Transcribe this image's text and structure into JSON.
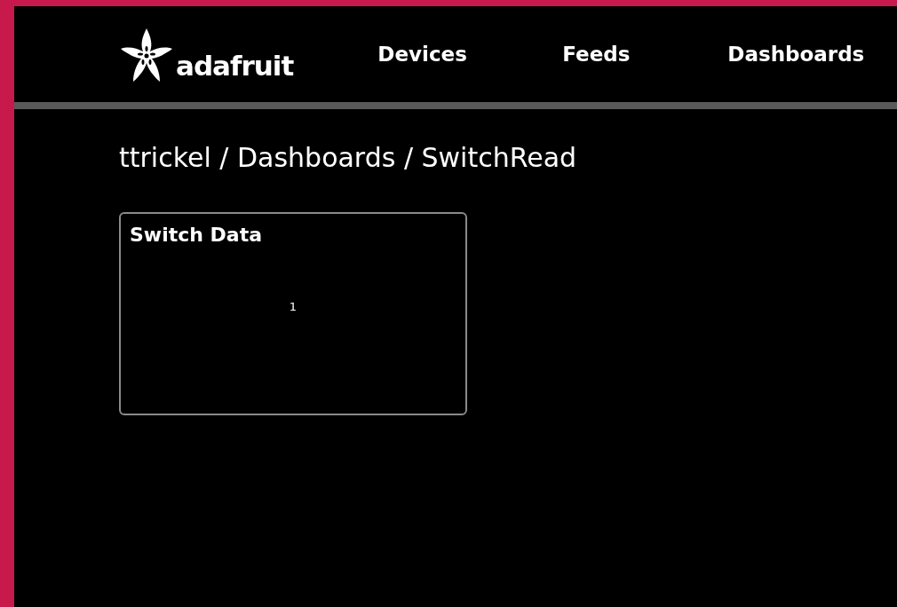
{
  "header": {
    "logo_text": "adafruit",
    "nav": [
      {
        "label": "Devices"
      },
      {
        "label": "Feeds"
      },
      {
        "label": "Dashboards"
      }
    ]
  },
  "breadcrumb": "ttrickel / Dashboards / SwitchRead",
  "blocks": [
    {
      "kind": "text",
      "title": "Switch Data",
      "value": "1"
    }
  ]
}
